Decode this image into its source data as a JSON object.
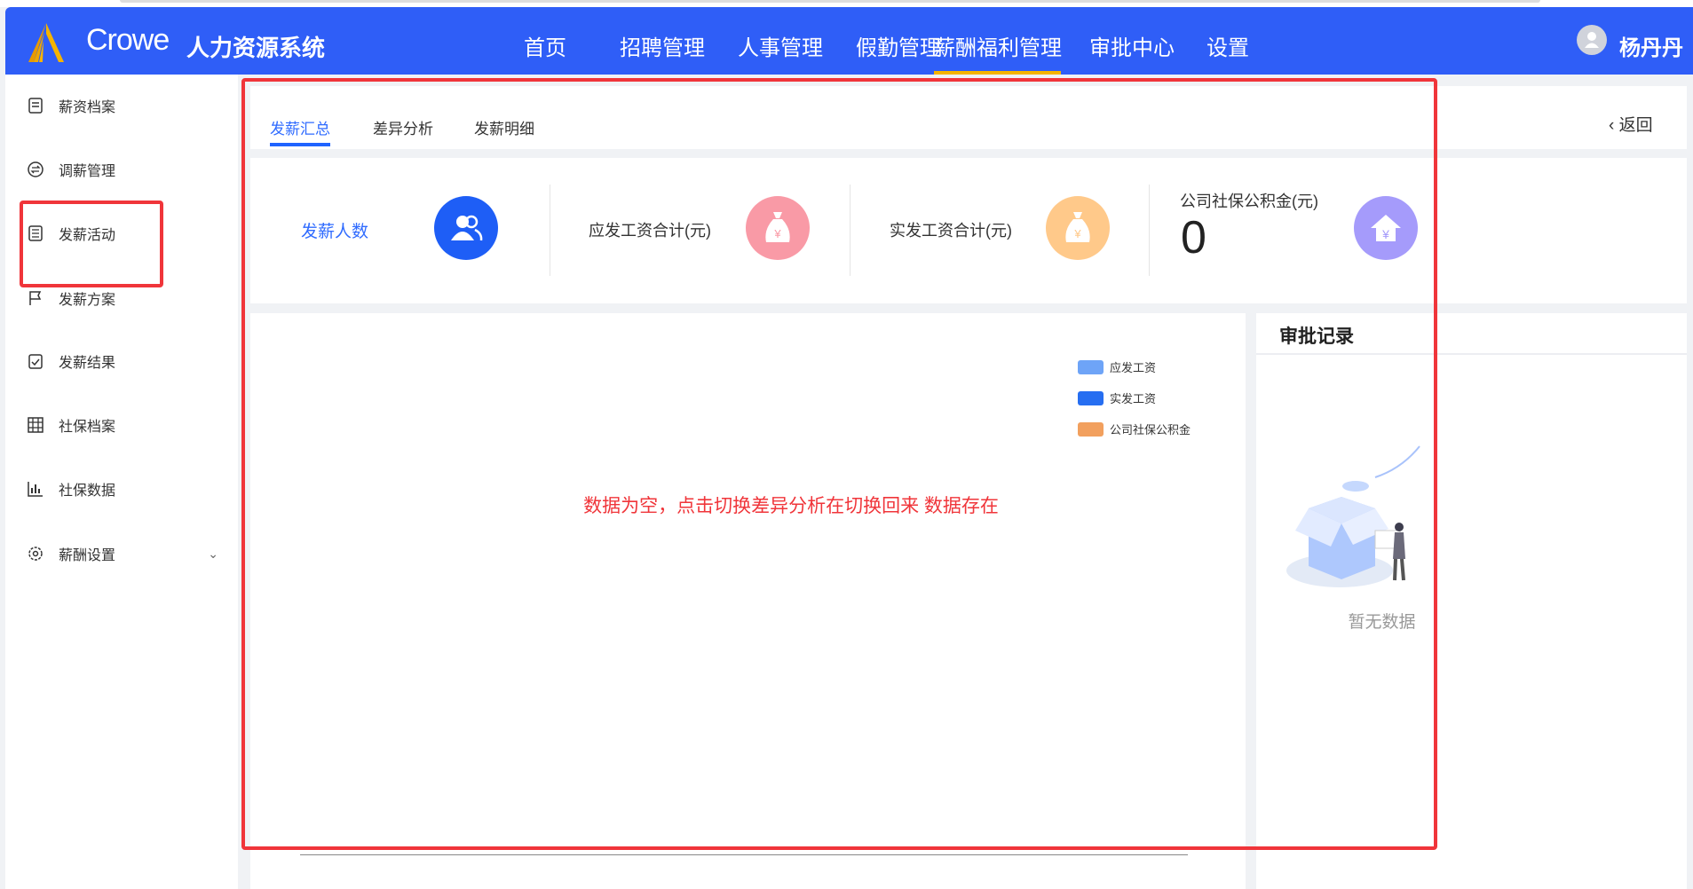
{
  "header": {
    "brand": "Crowe",
    "system_name": "人力资源系统",
    "nav": [
      "首页",
      "招聘管理",
      "人事管理",
      "假勤管理",
      "薪酬福利管理",
      "审批中心",
      "设置"
    ],
    "active_nav": "薪酬福利管理",
    "user": "杨丹丹",
    "accent": "#2f5ef7",
    "active_underline": "#f5b400"
  },
  "sidebar": {
    "items": [
      {
        "label": "薪资档案",
        "icon": "document-icon"
      },
      {
        "label": "调薪管理",
        "icon": "exchange-icon"
      },
      {
        "label": "发薪活动",
        "icon": "list-icon"
      },
      {
        "label": "发薪方案",
        "icon": "flag-icon"
      },
      {
        "label": "发薪结果",
        "icon": "clipboard-check-icon"
      },
      {
        "label": "社保档案",
        "icon": "grid-icon"
      },
      {
        "label": "社保数据",
        "icon": "bar-chart-icon"
      },
      {
        "label": "薪酬设置",
        "icon": "gear-icon"
      }
    ]
  },
  "tabs": [
    "发薪汇总",
    "差异分析",
    "发薪明细"
  ],
  "active_tab": "发薪汇总",
  "back_label": "返回",
  "stats": [
    {
      "label": "发薪人数",
      "color": "#1e5ef6"
    },
    {
      "label": "应发工资合计(元)",
      "color": "#f99aa6"
    },
    {
      "label": "实发工资合计(元)",
      "color": "#ffc98a"
    },
    {
      "label": "公司社保公积金(元)",
      "value": "0",
      "color": "#a59bfb"
    }
  ],
  "chart": {
    "legend": [
      {
        "label": "应发工资",
        "color": "#6ea4f7"
      },
      {
        "label": "实发工资",
        "color": "#266ef1"
      },
      {
        "label": "公司社保公积金",
        "color": "#f2a05e"
      }
    ],
    "annotation": "数据为空，点击切换差异分析在切换回来 数据存在"
  },
  "approval": {
    "title": "审批记录",
    "empty_text": "暂无数据"
  }
}
